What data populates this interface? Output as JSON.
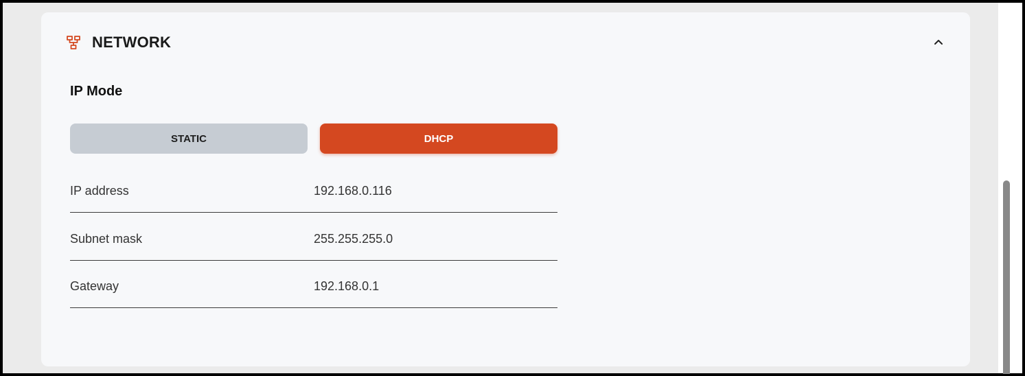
{
  "network": {
    "title": "NETWORK",
    "icon": "network-tree-icon",
    "accent_color": "#d44820",
    "ip_mode": {
      "label": "IP Mode",
      "options": [
        "STATIC",
        "DHCP"
      ],
      "selected": "DHCP"
    },
    "fields": [
      {
        "label": "IP address",
        "value": "192.168.0.116"
      },
      {
        "label": "Subnet mask",
        "value": "255.255.255.0"
      },
      {
        "label": "Gateway",
        "value": "192.168.0.1"
      }
    ]
  }
}
